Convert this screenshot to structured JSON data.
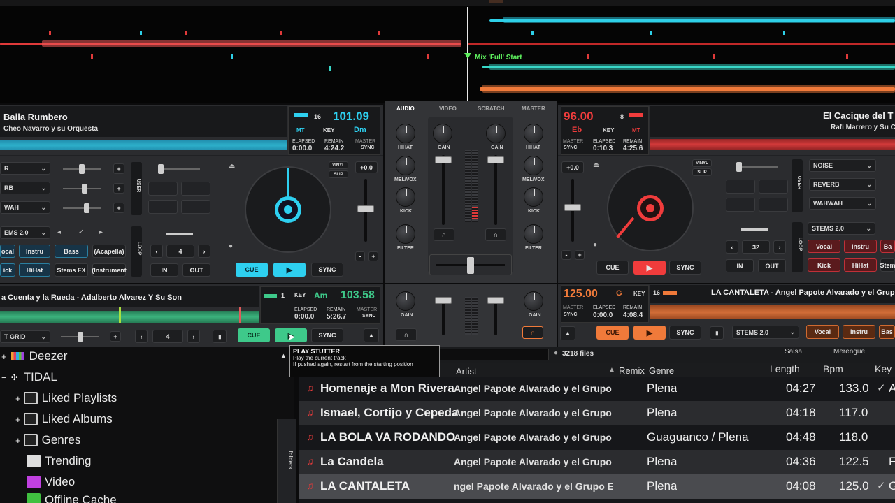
{
  "waveform": {
    "cue_label": "Mix 'Full' Start"
  },
  "mixer": {
    "tabs": [
      "AUDIO",
      "VIDEO",
      "SCRATCH",
      "MASTER"
    ],
    "labels": {
      "hihat": "HIHAT",
      "melvox": "MEL/VOX",
      "kick": "KICK",
      "filter": "FILTER",
      "gain": "GAIN"
    }
  },
  "deck1": {
    "title": "Baila Rumbero",
    "artist": "Cheo Navarro y su Orquesta",
    "bpm": "101.09",
    "beats": "16",
    "mt": "MT",
    "key_label": "KEY",
    "key": "Dm",
    "elapsed_label": "ELAPSED",
    "elapsed": "0:00.0",
    "remain_label": "REMAIN",
    "remain": "4:24.2",
    "master_label": "MASTER",
    "sync_label": "SYNC",
    "fx": [
      "R",
      "RB",
      "WAH"
    ],
    "pitch": "+0.0",
    "vinyl": "VINYL",
    "slip": "SLIP",
    "user": "USER",
    "loop": "LOOP",
    "loop_value": "4",
    "in": "IN",
    "out": "OUT",
    "cue": "CUE",
    "sync": "SYNC",
    "stems": "EMS 2.0",
    "stem_pads": [
      "ocal",
      "Instru",
      "Bass",
      "(Acapella)",
      "ick",
      "HiHat",
      "Stems FX",
      "(Instrument"
    ]
  },
  "deck2": {
    "title": "El Cacique del T",
    "artist": "Rafi Marrero y Su C",
    "bpm": "96.00",
    "beats": "8",
    "mt": "MT",
    "key_label": "KEY",
    "key": "Eb",
    "elapsed": "0:10.3",
    "remain": "4:25.6",
    "master_label": "MASTER",
    "sync_label": "SYNC",
    "elapsed_label": "ELAPSED",
    "remain_label": "REMAIN",
    "fx": [
      "NOISE",
      "REVERB",
      "WAHWAH"
    ],
    "pitch": "+0.0",
    "vinyl": "VINYL",
    "slip": "SLIP",
    "user": "USER",
    "loop": "LOOP",
    "loop_value": "32",
    "in": "IN",
    "out": "OUT",
    "cue": "CUE",
    "sync": "SYNC",
    "stems": "STEMS 2.0",
    "stem_pads": [
      "Vocal",
      "Instru",
      "Ba",
      "Kick",
      "HiHat",
      "Stem"
    ]
  },
  "deck3": {
    "title": "a Cuenta y la Rueda - Adalberto Alvarez Y Su Son",
    "beats": "1",
    "key_label": "KEY",
    "key": "Am",
    "bpm": "103.58",
    "elapsed_label": "ELAPSED",
    "elapsed": "0:00.0",
    "remain_label": "REMAIN",
    "remain": "5:26.7",
    "master_label": "MASTER",
    "sync_label": "SYNC",
    "grid": "T GRID",
    "loop_value": "4",
    "cue": "CUE",
    "sync": "SYNC"
  },
  "deck4": {
    "bpm": "125.00",
    "key": "G",
    "key_label": "KEY",
    "beats": "16",
    "title": "LA CANTALETA - Angel Papote Alvarado y el Grup",
    "master_label": "MASTER",
    "sync_label": "SYNC",
    "elapsed_label": "ELAPSED",
    "elapsed": "0:00.0",
    "remain_label": "REMAIN",
    "remain": "4:08.4",
    "cue": "CUE",
    "sync": "SYNC",
    "stems": "STEMS 2.0",
    "stem_pads": [
      "Vocal",
      "Instru",
      "Bas"
    ]
  },
  "tooltip": {
    "title": "PLAY STUTTER",
    "line1": "Play the current track",
    "line2": "If pushed again, restart from the starting position"
  },
  "browser": {
    "file_count": "3218 files",
    "filter_tags": [
      "Salsa",
      "Merengue"
    ],
    "sources": [
      "Deezer",
      "TIDAL",
      "Liked Playlists",
      "Liked Albums",
      "Genres",
      "Trending",
      "Video",
      "Offline Cache"
    ],
    "folders_tab": "folders",
    "columns": [
      "Artist",
      "Remix",
      "Genre",
      "Length",
      "Bpm",
      "Key"
    ],
    "rows": [
      {
        "title": "Homenaje a Mon Rivera",
        "artist": "Angel Papote Alvarado y el Grupo Esenci",
        "genre": "Plena",
        "length": "04:27",
        "bpm": "133.0",
        "key": "A"
      },
      {
        "title": "Ismael, Cortijo y Cepeda",
        "artist": "Angel Papote Alvarado y el Grupo Esenci",
        "genre": "Plena",
        "length": "04:18",
        "bpm": "117.0",
        "key": ""
      },
      {
        "title": "LA BOLA VA RODANDO",
        "artist": "Angel Papote Alvarado y el Grupo Esenci",
        "genre": "Guaguanco /  Plena",
        "length": "04:48",
        "bpm": "118.0",
        "key": ""
      },
      {
        "title": "La Candela",
        "artist": "Angel Papote Alvarado y el Grupo Esenci",
        "genre": "Plena",
        "length": "04:36",
        "bpm": "122.5",
        "key": "F"
      },
      {
        "title": "LA CANTALETA",
        "artist": "ngel Papote Alvarado y el Grupo Esencia",
        "genre": "Plena",
        "length": "04:08",
        "bpm": "125.0",
        "key": "G"
      }
    ]
  },
  "colors": {
    "deck_blue": "#2ed0f0",
    "deck_red": "#f03c3c",
    "deck_green": "#3ec98a",
    "deck_orange": "#f07a3a"
  }
}
